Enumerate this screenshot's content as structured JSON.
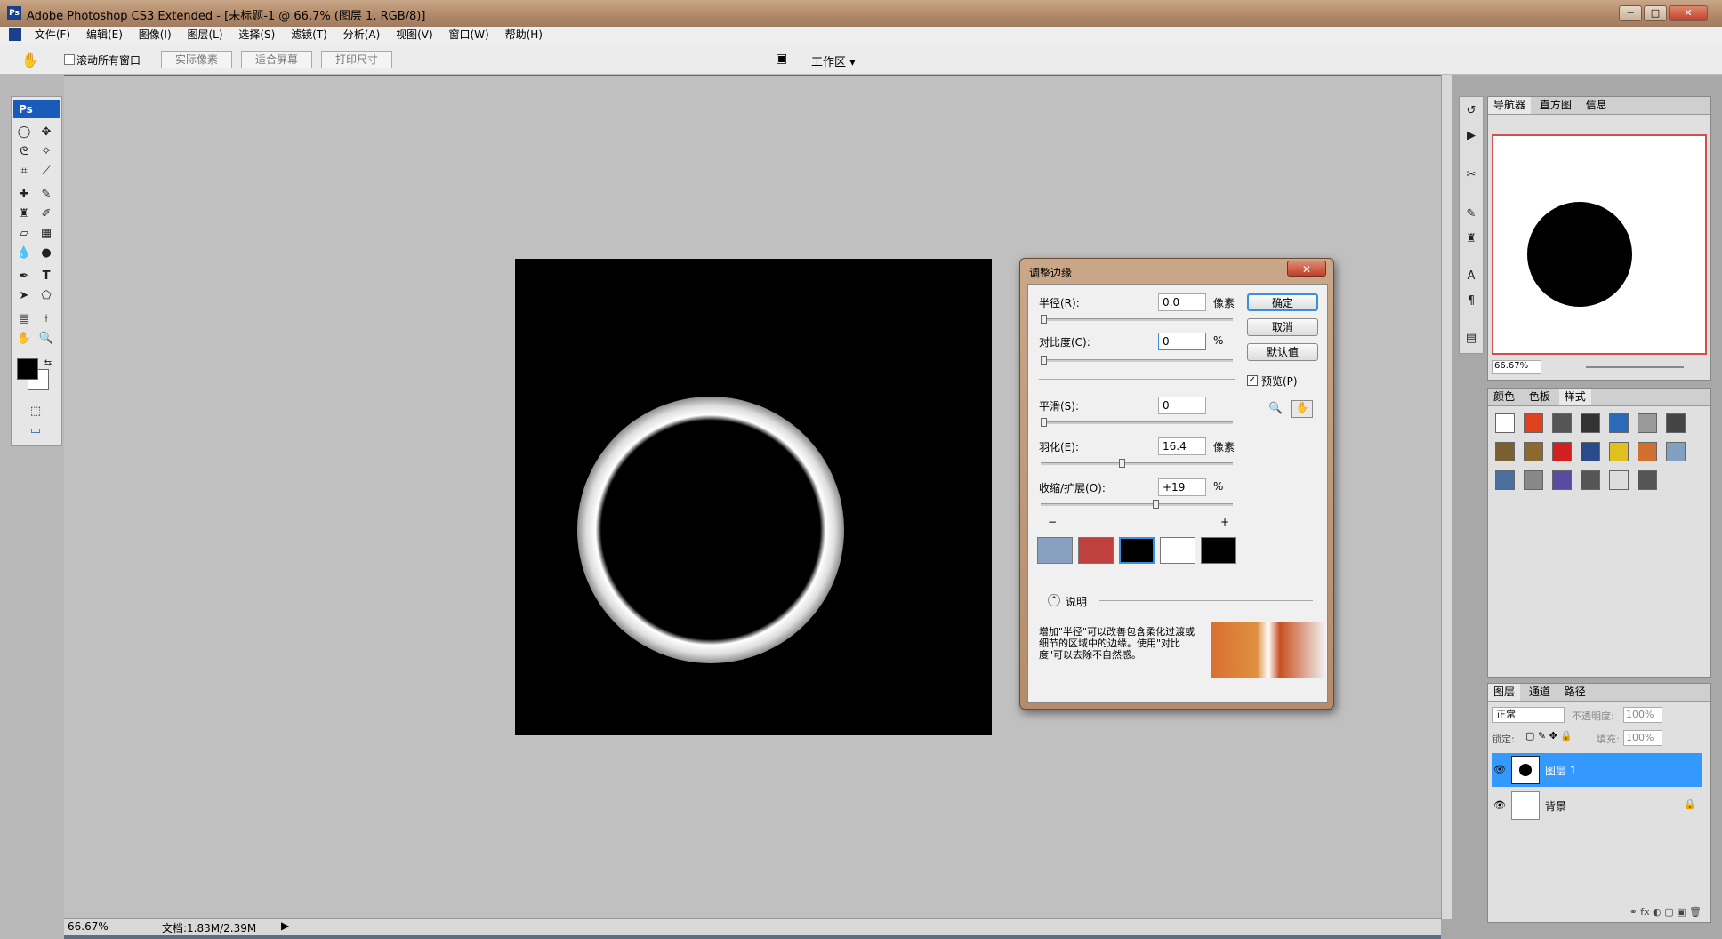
{
  "app": {
    "title": "Adobe Photoshop CS3 Extended - [未标题-1 @ 66.7% (图层 1, RGB/8)]"
  },
  "menu": [
    "文件(F)",
    "编辑(E)",
    "图像(I)",
    "图层(L)",
    "选择(S)",
    "滤镜(T)",
    "分析(A)",
    "视图(V)",
    "窗口(W)",
    "帮助(H)"
  ],
  "options": {
    "scroll_all": "滚动所有窗口",
    "actual_pixels": "实际像素",
    "fit_screen": "适合屏幕",
    "print_size": "打印尺寸",
    "workspace": "工作区 ▾"
  },
  "status": {
    "zoom": "66.67%",
    "doc": "文档:1.83M/2.39M"
  },
  "dialog": {
    "title": "调整边缘",
    "radius": {
      "label": "半径(R):",
      "value": "0.0",
      "unit": "像素"
    },
    "contrast": {
      "label": "对比度(C):",
      "value": "0",
      "unit": "%"
    },
    "smooth": {
      "label": "平滑(S):",
      "value": "0"
    },
    "feather": {
      "label": "羽化(E):",
      "value": "16.4",
      "unit": "像素"
    },
    "contract": {
      "label": "收缩/扩展(O):",
      "value": "+19",
      "unit": "%",
      "minus": "−",
      "plus": "+"
    },
    "buttons": {
      "ok": "确定",
      "cancel": "取消",
      "default": "默认值"
    },
    "preview": "预览(P)",
    "desc_title": "说明",
    "desc_text": "增加\"半径\"可以改善包含柔化过渡或细节的区域中的边缘。使用\"对比度\"可以去除不自然感。"
  },
  "navigator": {
    "tabs": [
      "导航器",
      "直方图",
      "信息"
    ],
    "zoom": "66.67%"
  },
  "styles_panel": {
    "tabs": [
      "颜色",
      "色板",
      "样式"
    ]
  },
  "layers": {
    "tabs": [
      "图层",
      "通道",
      "路径"
    ],
    "blend": "正常",
    "opacity_label": "不透明度:",
    "opacity": "100%",
    "lock_label": "锁定:",
    "fill_label": "填充:",
    "fill": "100%",
    "items": [
      {
        "name": "图层 1"
      },
      {
        "name": "背景"
      }
    ]
  },
  "colors": {
    "selected_layer": "#3399ff",
    "swatches": [
      "#ffffff",
      "#e04020",
      "#555555",
      "#333333",
      "#2a6ab8",
      "#999999",
      "#444444",
      "#7a6030",
      "#8a6a30",
      "#d02020",
      "#2a4a8a",
      "#e0c020",
      "#d07030",
      "#80a0c0",
      "#4a70a0",
      "#888888",
      "#5a4aa0",
      "#555555",
      "#dddddd",
      "#555555"
    ]
  }
}
